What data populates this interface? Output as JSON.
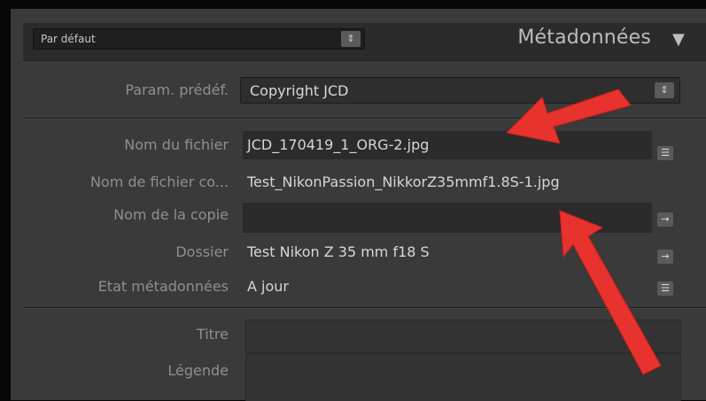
{
  "header": {
    "preset_value": "Par défaut",
    "panel_title": "Métadonnées",
    "collapse_glyph": "▼"
  },
  "preset_row": {
    "label": "Param. prédéf.",
    "value": "Copyright JCD"
  },
  "file_fields": [
    {
      "label": "Nom du fichier",
      "value": "JCD_170419_1_ORG-2.jpg",
      "button": "list-icon"
    },
    {
      "label": "Nom de fichier co...",
      "value": "Test_NikonPassion_NikkorZ35mmf1.8S-1.jpg",
      "button": ""
    },
    {
      "label": "Nom de la copie",
      "value": "",
      "button": "arrow-right-icon"
    },
    {
      "label": "Dossier",
      "value": "Test Nikon Z 35 mm f18 S",
      "button": "arrow-right-icon"
    },
    {
      "label": "Etat métadonnées",
      "value": "A jour",
      "button": "list-icon"
    }
  ],
  "text_fields": [
    {
      "label": "Titre",
      "value": ""
    },
    {
      "label": "Légende",
      "value": ""
    }
  ],
  "icons": {
    "spinner": "⇕",
    "list": "☰",
    "arrow_right": "→"
  },
  "colors": {
    "panel_bg": "#3a3a3a",
    "header_bg": "#2b2b2b",
    "label_text": "#8f8f8f",
    "value_text": "#d6d6d6",
    "annotation_arrow": "#e8322e"
  }
}
